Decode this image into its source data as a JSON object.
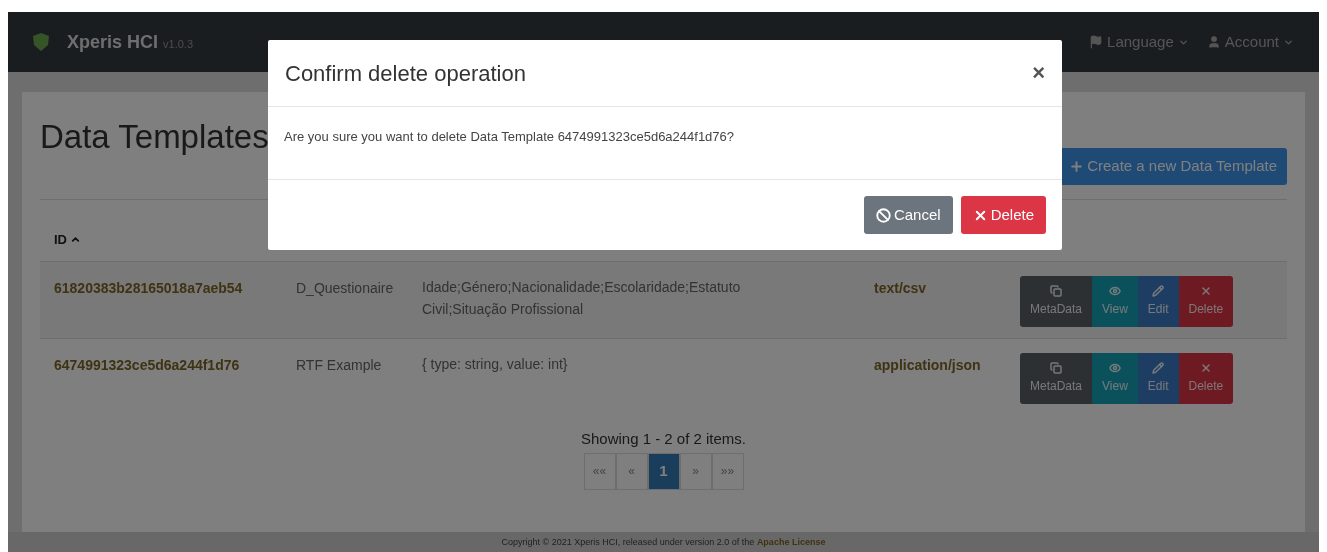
{
  "navbar": {
    "brand": "Xperis HCI",
    "version": "v1.0.3",
    "items": [
      {
        "label": "Language",
        "kind": "flag",
        "dropdown": true
      },
      {
        "label": "Account",
        "kind": "user",
        "dropdown": true
      }
    ]
  },
  "page": {
    "title": "Data Templates",
    "create_button": "Create a new Data Template"
  },
  "table": {
    "columns": [
      {
        "label": "ID",
        "sorted": true
      }
    ],
    "rows": [
      {
        "id": "61820383b28165018a7aeb54",
        "name": "D_Questionaire",
        "description": "Idade;Género;Nacionalidade;Escolaridade;Estatuto Civil;Situação Profissional",
        "content_type": "text/csv",
        "actions": [
          {
            "kind": "metadata",
            "label": "MetaData"
          },
          {
            "kind": "view",
            "label": "View"
          },
          {
            "kind": "edit",
            "label": "Edit"
          },
          {
            "kind": "delete",
            "label": "Delete"
          }
        ]
      },
      {
        "id": "6474991323ce5d6a244f1d76",
        "name": "RTF Example",
        "description": "{ type: string, value: int}",
        "content_type": "application/json",
        "actions": [
          {
            "kind": "metadata",
            "label": "MetaData"
          },
          {
            "kind": "view",
            "label": "View"
          },
          {
            "kind": "edit",
            "label": "Edit"
          },
          {
            "kind": "delete",
            "label": "Delete"
          }
        ]
      }
    ]
  },
  "pagination": {
    "summary": "Showing 1 - 2 of 2 items.",
    "pages": [
      {
        "label": "««",
        "selected": false
      },
      {
        "label": "«",
        "selected": false
      },
      {
        "label": "1",
        "selected": true
      },
      {
        "label": "»",
        "selected": false
      },
      {
        "label": "»»",
        "selected": false
      }
    ]
  },
  "footer": {
    "text": "Copyright © 2021 Xperis HCI, released under version 2.0 of the",
    "link": "Apache License"
  },
  "dialog": {
    "title": "Confirm delete operation",
    "close": "×",
    "message": "Are you sure you want to delete Data Template 6474991323ce5d6a244f1d76?",
    "buttons": [
      {
        "kind": "cancel",
        "label": "Cancel"
      },
      {
        "kind": "delete",
        "label": "Delete"
      }
    ]
  }
}
